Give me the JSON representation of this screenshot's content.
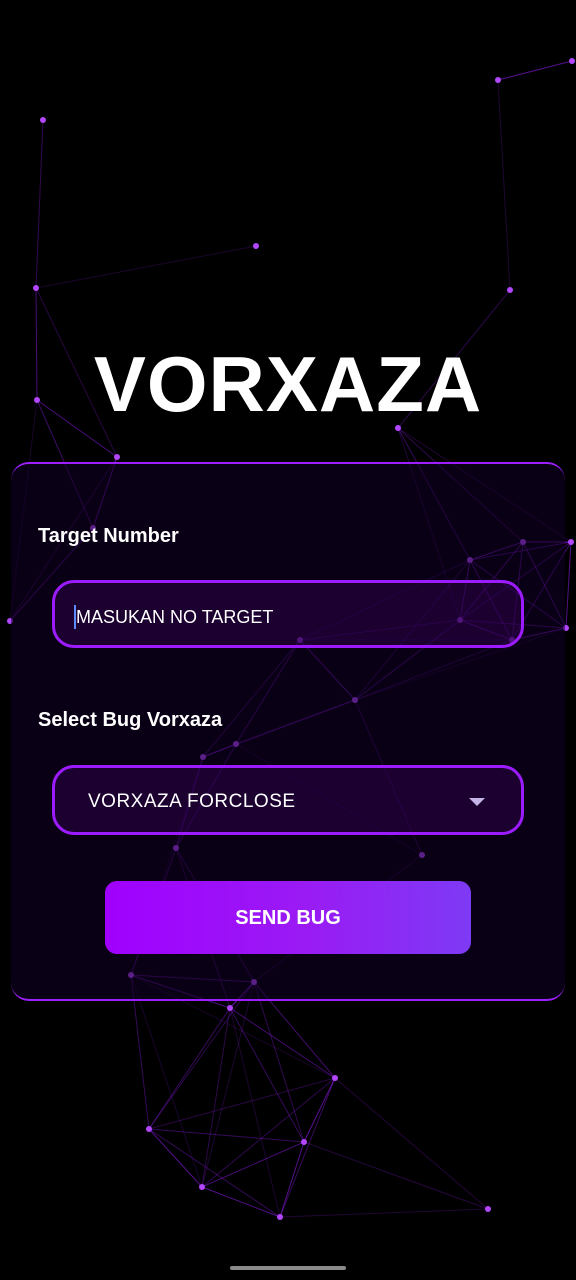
{
  "app": {
    "title": "VORXAZA"
  },
  "form": {
    "target_label": "Target Number",
    "target_placeholder": "MASUKAN NO TARGET",
    "target_value": "",
    "bug_label": "Select Bug Vorxaza",
    "bug_selected": "VORXAZA FORCLOSE",
    "send_label": "SEND BUG"
  },
  "theme": {
    "background": "#000000",
    "accent": "#9d1fff",
    "button_gradient_start": "#a000ff",
    "button_gradient_end": "#7e3af5",
    "network_color": "#9b1cff"
  },
  "icons": {
    "dropdown": "chevron-down-icon"
  }
}
